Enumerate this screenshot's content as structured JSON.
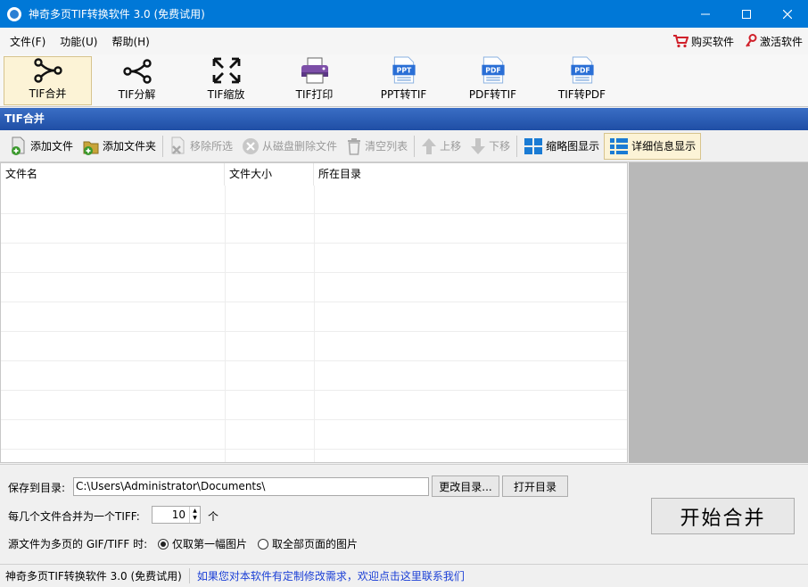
{
  "window": {
    "title": "神奇多页TIF转换软件 3.0 (免费试用)"
  },
  "menu": {
    "items": [
      {
        "label": "文件(F)"
      },
      {
        "label": "功能(U)"
      },
      {
        "label": "帮助(H)"
      }
    ],
    "buy_label": "购买软件",
    "activate_label": "激活软件"
  },
  "toolbar": {
    "items": [
      {
        "label": "TIF合并",
        "icon": "merge-icon"
      },
      {
        "label": "TIF分解",
        "icon": "split-icon"
      },
      {
        "label": "TIF缩放",
        "icon": "resize-icon"
      },
      {
        "label": "TIF打印",
        "icon": "printer-icon"
      },
      {
        "label": "PPT转TIF",
        "icon": "ppt-file-icon",
        "badge": "PPT"
      },
      {
        "label": "PDF转TIF",
        "icon": "pdf-file-icon",
        "badge": "PDF"
      },
      {
        "label": "TIF转PDF",
        "icon": "pdf-file-icon",
        "badge": "PDF"
      }
    ]
  },
  "panel": {
    "title": "TIF合并"
  },
  "subtoolbar": {
    "add_file": "添加文件",
    "add_folder": "添加文件夹",
    "remove_selected": "移除所选",
    "delete_from_disk": "从磁盘删除文件",
    "clear_list": "清空列表",
    "move_up": "上移",
    "move_down": "下移",
    "thumbnail_view": "缩略图显示",
    "detail_view": "详细信息显示"
  },
  "filelist": {
    "columns": [
      "文件名",
      "文件大小",
      "所在目录"
    ],
    "rows": []
  },
  "bottom": {
    "save_label": "保存到目录:",
    "save_path": "C:\\Users\\Administrator\\Documents\\",
    "change_dir": "更改目录...",
    "open_dir": "打开目录",
    "merge_count_label": "每几个文件合并为一个TIFF:",
    "merge_count": "10",
    "merge_unit": "个",
    "multipage_label": "源文件为多页的 GIF/TIFF 时:",
    "option_first": "仅取第一幅图片",
    "option_all": "取全部页面的图片",
    "start_button": "开始合并"
  },
  "status": {
    "left": "神奇多页TIF转换软件 3.0 (免费试用)",
    "right": "如果您对本软件有定制修改需求，欢迎点击这里联系我们"
  },
  "colors": {
    "accent": "#0078d7",
    "panel_header": "#1f4ea5",
    "link": "#1b3fd6"
  }
}
